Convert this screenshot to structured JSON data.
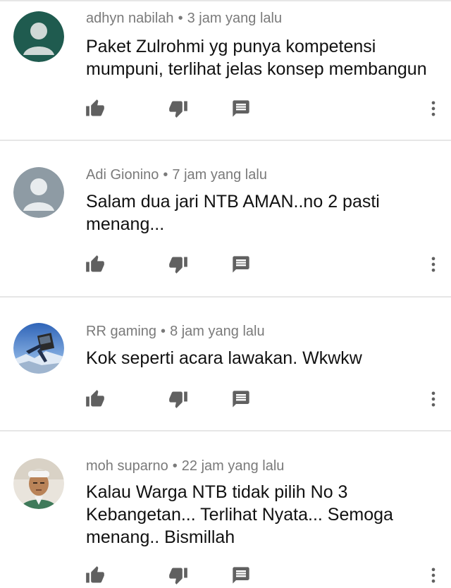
{
  "comments": [
    {
      "author": "adhyn nabilah",
      "time": "3 jam yang lalu",
      "separator": "•",
      "text": "Paket Zulrohmi yg punya kompetensi mumpuni, terlihat jelas konsep membangun",
      "avatar": {
        "type": "default",
        "color": "#1f5b4f"
      }
    },
    {
      "author": "Adi Gionino",
      "time": "7 jam yang lalu",
      "separator": "•",
      "text": "Salam dua jari NTB AMAN..no 2 pasti menang...",
      "avatar": {
        "type": "default",
        "color": "#8e9ba4"
      }
    },
    {
      "author": "RR gaming",
      "time": "8 jam yang lalu",
      "separator": "•",
      "text": "Kok seperti acara lawakan. Wkwkw",
      "avatar": {
        "type": "photo",
        "color": "#5a8fd6"
      }
    },
    {
      "author": "moh suparno",
      "time": "22 jam yang lalu",
      "separator": "•",
      "text": "Kalau Warga NTB tidak pilih No 3 Kebangetan... Terlihat Nyata... Semoga menang.. Bismillah",
      "avatar": {
        "type": "photo",
        "color": "#c9a07a"
      }
    }
  ],
  "icons": {
    "like": "thumb-up-icon",
    "dislike": "thumb-down-icon",
    "reply": "reply-icon",
    "more": "more-vert-icon"
  },
  "colors": {
    "icon": "#606060",
    "meta": "#7a7a7a",
    "divider": "#e6e6e6"
  }
}
